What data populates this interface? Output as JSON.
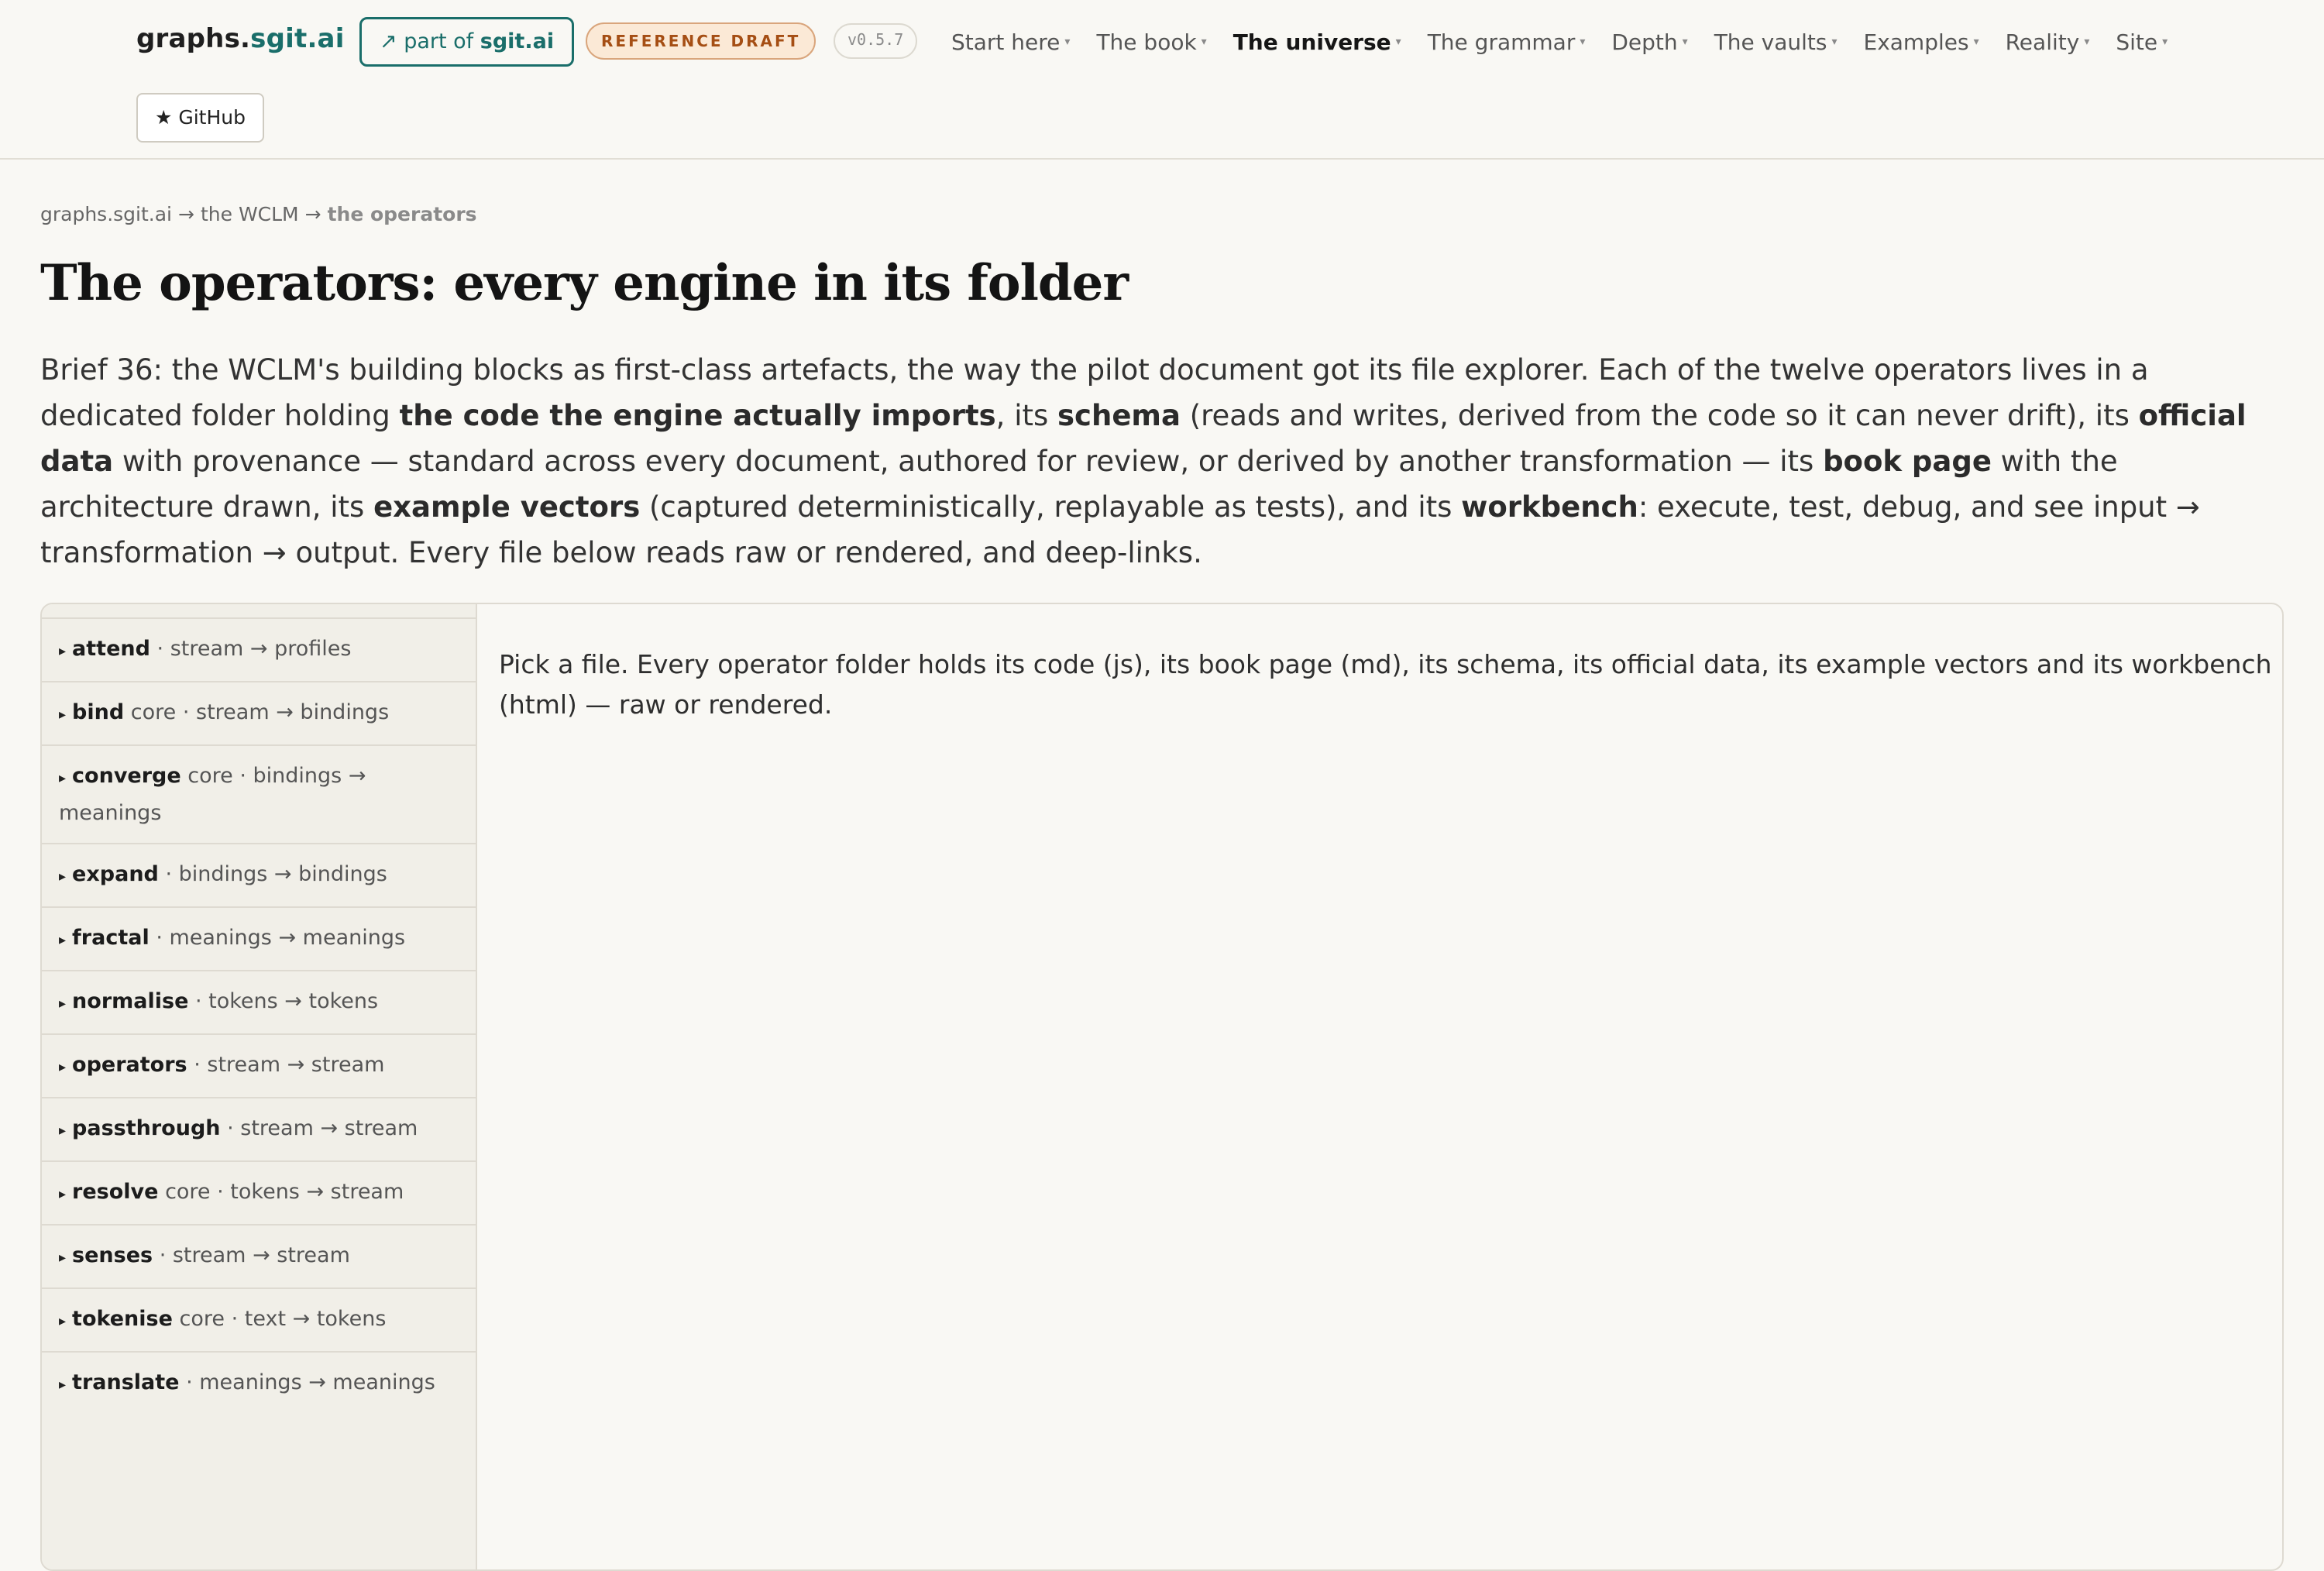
{
  "header": {
    "brand_main": "graphs.",
    "brand_accent": "sgit.ai",
    "partof_prefix": "↗ part of ",
    "partof_strong": "sgit.ai",
    "draft_badge": "REFERENCE DRAFT",
    "version": "v0.5.7",
    "github_label": "★ GitHub",
    "nav": [
      {
        "label": "Start here",
        "active": false
      },
      {
        "label": "The book",
        "active": false
      },
      {
        "label": "The universe",
        "active": true
      },
      {
        "label": "The grammar",
        "active": false
      },
      {
        "label": "Depth",
        "active": false
      },
      {
        "label": "The vaults",
        "active": false
      },
      {
        "label": "Examples",
        "active": false
      },
      {
        "label": "Reality",
        "active": false
      },
      {
        "label": "Site",
        "active": false
      }
    ],
    "caret": "▾"
  },
  "breadcrumb": {
    "items": [
      "graphs.sgit.ai",
      "the WCLM",
      "the operators"
    ],
    "separator": "→"
  },
  "page": {
    "title": "The operators: every engine in its folder"
  },
  "intro": {
    "t1": "Brief 36: the WCLM's building blocks as first-class artefacts, the way the pilot document got its file explorer. Each of the twelve operators lives in a dedicated folder holding ",
    "b1": "the code the engine actually imports",
    "t2": ", its ",
    "b2": "schema",
    "t3": " (reads and writes, derived from the code so it can never drift), its ",
    "b3": "official data",
    "t4": " with provenance — standard across every document, authored for review, or derived by another transformation — its ",
    "b4": "book page",
    "t5": " with the architecture drawn, its ",
    "b5": "example vectors",
    "t6": " (captured deterministically, replayable as tests), and its ",
    "b6": "workbench",
    "t7": ": execute, test, debug, and see input → transformation → output. Every file below reads raw or rendered, and deep-links."
  },
  "explorer": {
    "tree_marker": "▸",
    "operators": [
      {
        "name": "attend",
        "core": "",
        "io": "· stream → profiles"
      },
      {
        "name": "bind",
        "core": "core",
        "io": "· stream → bindings"
      },
      {
        "name": "converge",
        "core": "core",
        "io": "· bindings → meanings"
      },
      {
        "name": "expand",
        "core": "",
        "io": "· bindings → bindings"
      },
      {
        "name": "fractal",
        "core": "",
        "io": "· meanings → meanings"
      },
      {
        "name": "normalise",
        "core": "",
        "io": "· tokens → tokens"
      },
      {
        "name": "operators",
        "core": "",
        "io": "· stream → stream"
      },
      {
        "name": "passthrough",
        "core": "",
        "io": "· stream → stream"
      },
      {
        "name": "resolve",
        "core": "core",
        "io": "· tokens → stream"
      },
      {
        "name": "senses",
        "core": "",
        "io": "· stream → stream"
      },
      {
        "name": "tokenise",
        "core": "core",
        "io": "· text → tokens"
      },
      {
        "name": "translate",
        "core": "",
        "io": "· meanings → meanings"
      }
    ],
    "viewer_placeholder": "Pick a file. Every operator folder holds its code (js), its book page (md), its schema, its official data, its example vectors and its workbench (html) — raw or rendered."
  },
  "colors": {
    "accent": "#1a6e6a",
    "badge_text": "#a54e14",
    "badge_bg": "#fbe9d6",
    "background": "#f9f8f4",
    "sidebar_bg": "#f1efe8"
  }
}
